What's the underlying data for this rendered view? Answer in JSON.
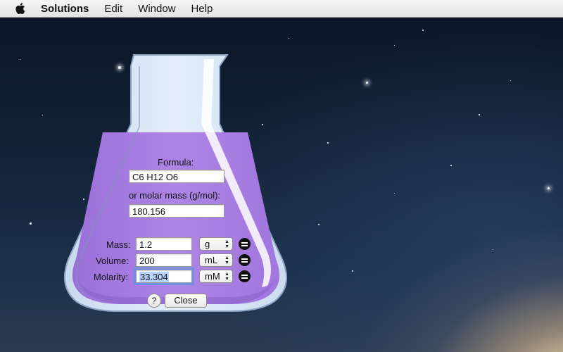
{
  "menubar": {
    "app_name": "Solutions",
    "items": [
      "Edit",
      "Window",
      "Help"
    ]
  },
  "form": {
    "formula_label": "Formula:",
    "formula_value": "C6 H12 O6",
    "molar_mass_label": "or molar mass (g/mol):",
    "molar_mass_value": "180.156",
    "rows": [
      {
        "label": "Mass:",
        "value": "1.2",
        "unit": "g"
      },
      {
        "label": "Volume:",
        "value": "200",
        "unit": "mL"
      },
      {
        "label": "Molarity:",
        "value": "33.304",
        "unit": "mM"
      }
    ],
    "help_label": "?",
    "close_label": "Close"
  },
  "colors": {
    "liquid": "#a77de0",
    "flask_glass": "#dbe8f6",
    "selection": "#b5d5ff"
  },
  "icons": {
    "apple": "apple-logo-icon",
    "equals": "equals-icon",
    "popup_arrows": "up-down-arrows-icon"
  }
}
